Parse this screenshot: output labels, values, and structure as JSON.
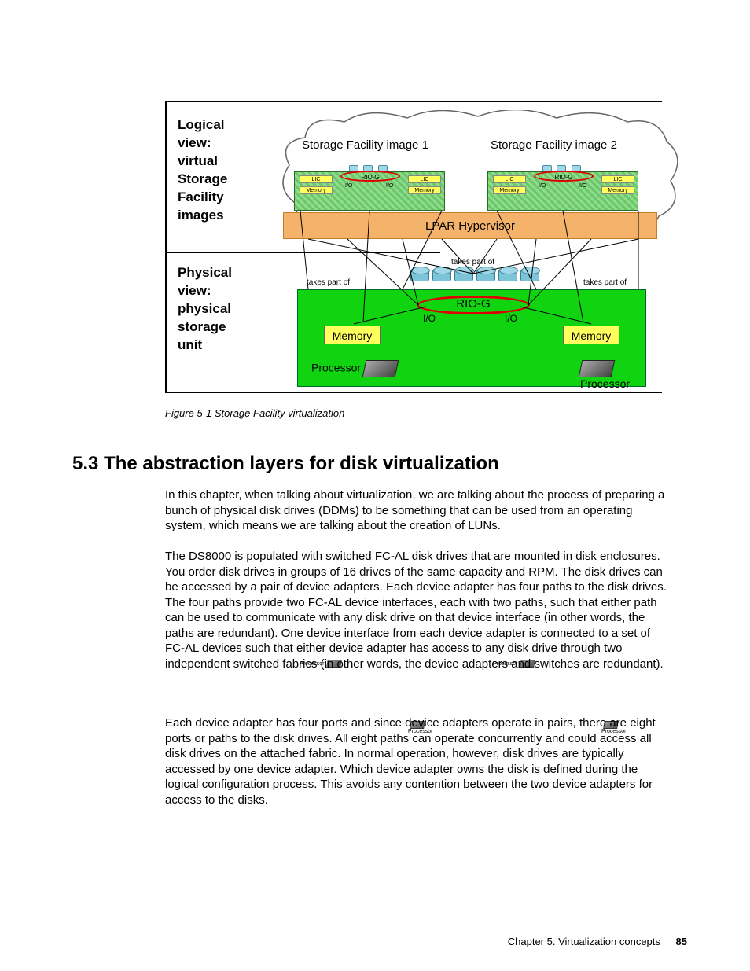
{
  "figure": {
    "label_logical": "Logical view:\nvirtual Storage Facility images",
    "label_logical_l1": "Logical",
    "label_logical_l2": "view:",
    "label_logical_l3": "virtual",
    "label_logical_l4": "Storage",
    "label_logical_l5": "Facility",
    "label_logical_l6": "images",
    "label_physical_l1": "Physical",
    "label_physical_l2": "view:",
    "label_physical_l3": "physical",
    "label_physical_l4": "storage",
    "label_physical_l5": "unit",
    "sfi1": "Storage Facility image 1",
    "sfi2": "Storage Facility image 2",
    "lic": "LIC",
    "memory_s": "Memory",
    "processor_s": "Processor",
    "rio_s": "RIO-G",
    "io_s": "I/O",
    "hypervisor": "LPAR Hypervisor",
    "takes": "takes part of",
    "rio_g": "RIO-G",
    "io": "I/O",
    "memory": "Memory",
    "processor": "Processor",
    "caption": "Figure 5-1   Storage Facility virtualization"
  },
  "section": {
    "heading": "5.3  The abstraction layers for disk virtualization",
    "p1": "In this chapter, when talking about virtualization, we are talking about the process of preparing a bunch of physical disk drives (DDMs) to be something that can be used from an operating system, which means we are talking about the creation of LUNs.",
    "p2": "The DS8000 is populated with switched FC-AL disk drives that are mounted in disk enclosures. You order disk drives in groups of 16 drives of the same capacity and RPM. The disk drives can be accessed by a pair of device adapters. Each device adapter has four paths to the disk drives. The four paths provide two FC-AL device interfaces, each with two paths, such that either path can be used to communicate with any disk drive on that device interface (in other words, the paths are redundant). One device interface from each device adapter is connected to a set of FC-AL devices such that either device adapter has access to any disk drive through two independent switched fabrics (in other words, the device adapters and switches are redundant).",
    "p3": "Each device adapter has four ports and since device adapters operate in pairs, there are eight ports or paths to the disk drives. All eight paths can operate concurrently and could access all disk drives on the attached fabric. In normal operation, however, disk drives are typically accessed by one device adapter. Which device adapter owns the disk is defined during the logical configuration process. This avoids any contention between the two device adapters for access to the disks."
  },
  "footer": {
    "chapter": "Chapter 5. Virtualization concepts",
    "page": "85"
  }
}
